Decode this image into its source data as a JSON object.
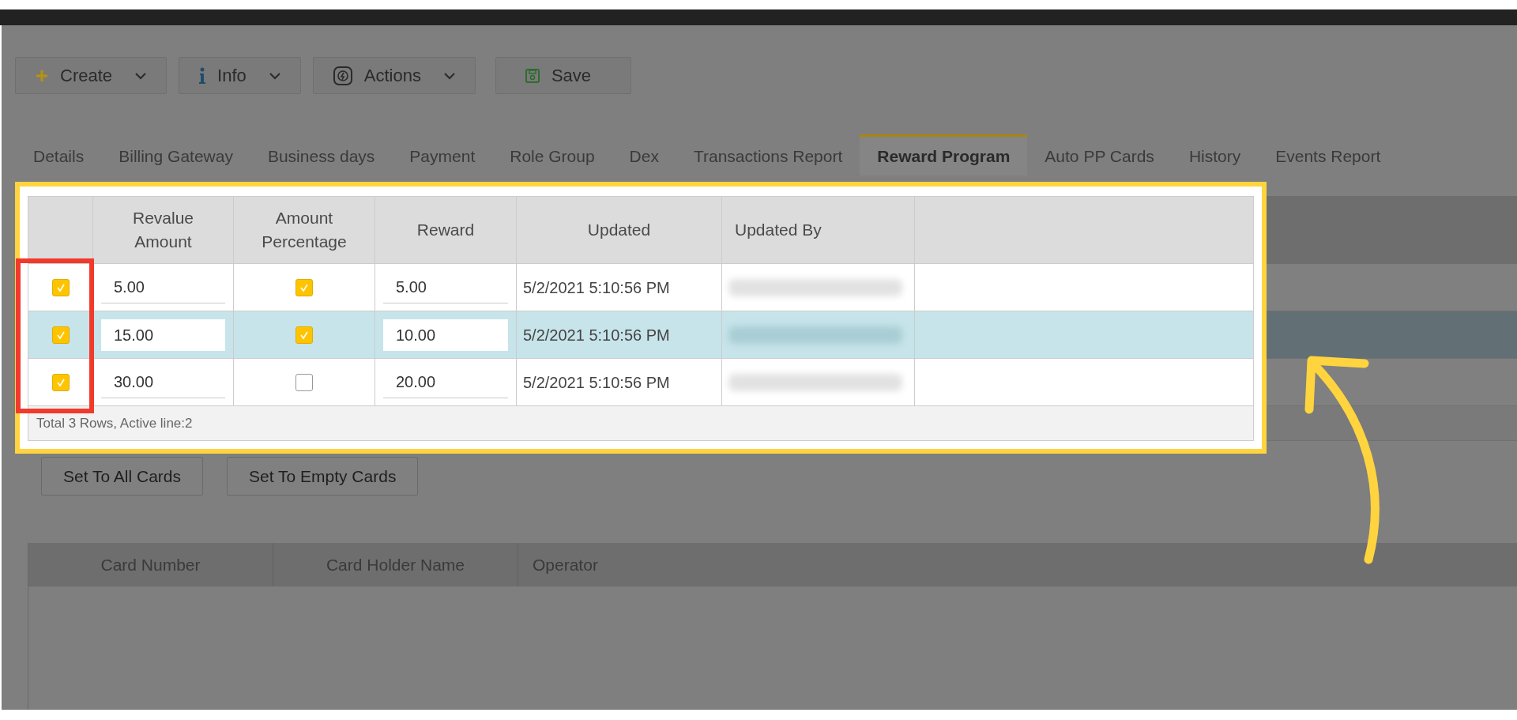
{
  "toolbar": [
    {
      "label": "Create",
      "kind": "dropdown"
    },
    {
      "label": "Info",
      "kind": "dropdown"
    },
    {
      "label": "Actions",
      "kind": "dropdown"
    },
    {
      "label": "Save",
      "kind": "button"
    }
  ],
  "tabs": [
    {
      "label": "Details",
      "selected": false
    },
    {
      "label": "Billing Gateway",
      "selected": false
    },
    {
      "label": "Business days",
      "selected": false
    },
    {
      "label": "Payment",
      "selected": false
    },
    {
      "label": "Role Group",
      "selected": false
    },
    {
      "label": "Dex",
      "selected": false
    },
    {
      "label": "Transactions Report",
      "selected": false
    },
    {
      "label": "Reward Program",
      "selected": true
    },
    {
      "label": "Auto PP Cards",
      "selected": false
    },
    {
      "label": "History",
      "selected": false
    },
    {
      "label": "Events Report",
      "selected": false
    }
  ],
  "reward_table": {
    "columns": [
      "Revalue\nAmount",
      "Amount\nPercentage",
      "Reward",
      "Updated",
      "Updated By"
    ],
    "rows": [
      {
        "selected": false,
        "checked": true,
        "revalue_amount": "5.00",
        "amount_percentage": true,
        "reward": "5.00",
        "updated": "5/2/2021 5:10:56 PM"
      },
      {
        "selected": true,
        "checked": true,
        "revalue_amount": "15.00",
        "amount_percentage": true,
        "reward": "10.00",
        "updated": "5/2/2021 5:10:56 PM"
      },
      {
        "selected": false,
        "checked": true,
        "revalue_amount": "30.00",
        "amount_percentage": false,
        "reward": "20.00",
        "updated": "5/2/2021 5:10:56 PM"
      }
    ],
    "footer": "Total 3 Rows, Active line:2"
  },
  "actions": [
    "Set To All Cards",
    "Set To Empty Cards"
  ],
  "cards_table": {
    "columns": [
      "Card Number",
      "Card Holder Name",
      "Operator"
    ]
  }
}
